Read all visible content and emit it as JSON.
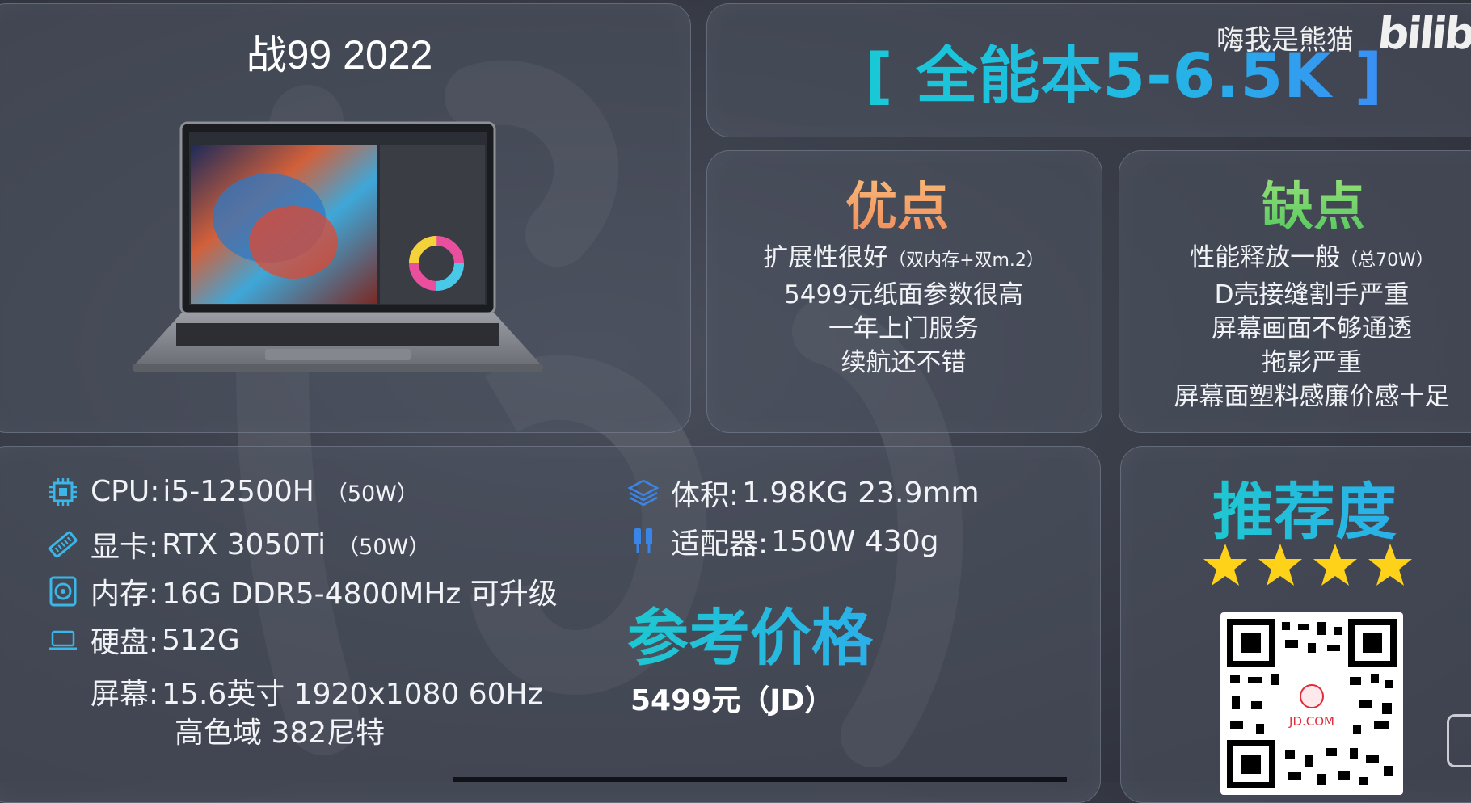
{
  "product": {
    "name": "战99 2022"
  },
  "title": {
    "text": "[ 全能本5-6.5K ]"
  },
  "overlay": {
    "uploader": "嗨我是熊猫",
    "site_logo": "bilibi"
  },
  "pros": {
    "heading": "优点",
    "items": [
      {
        "text": "扩展性很好",
        "note": "（双内存+双m.2）"
      },
      {
        "text": "5499元纸面参数很高",
        "note": ""
      },
      {
        "text": "一年上门服务",
        "note": ""
      },
      {
        "text": "续航还不错",
        "note": ""
      }
    ]
  },
  "cons": {
    "heading": "缺点",
    "items": [
      {
        "text": "性能释放一般",
        "note": "（总70W）"
      },
      {
        "text": "D壳接缝割手严重",
        "note": ""
      },
      {
        "text": "屏幕画面不够通透",
        "note": ""
      },
      {
        "text": "拖影严重",
        "note": ""
      },
      {
        "text": "屏幕面塑料感廉价感十足",
        "note": ""
      }
    ]
  },
  "specs": {
    "cpu": {
      "icon": "cpu-icon",
      "label": "CPU:",
      "value": "i5-12500H",
      "note": "（50W）"
    },
    "gpu": {
      "icon": "gpu-icon",
      "label": "显卡:",
      "value": "RTX 3050Ti",
      "note": "（50W）"
    },
    "memory": {
      "icon": "memory-icon",
      "label": "内存:",
      "value": "16G DDR5-4800MHz 可升级"
    },
    "storage": {
      "icon": "laptop-icon",
      "label": "硬盘:",
      "value": "512G"
    },
    "screen": {
      "label": "屏幕:",
      "value": "15.6英寸 1920x1080 60Hz",
      "value2": "高色域 382尼特"
    },
    "size": {
      "icon": "layers-icon",
      "label": "体积:",
      "value": "1.98KG 23.9mm"
    },
    "adapter": {
      "icon": "plug-icon",
      "label": "适配器:",
      "value": "150W 430g"
    }
  },
  "price": {
    "heading": "参考价格",
    "value": "5499元（JD）"
  },
  "recommend": {
    "heading": "推荐度",
    "stars": 4,
    "qr_label": "JD.COM"
  },
  "colors": {
    "accent": "#1ec8d0",
    "pros": "#f5a36a",
    "cons": "#6fd26a",
    "star": "#ffd21a"
  }
}
